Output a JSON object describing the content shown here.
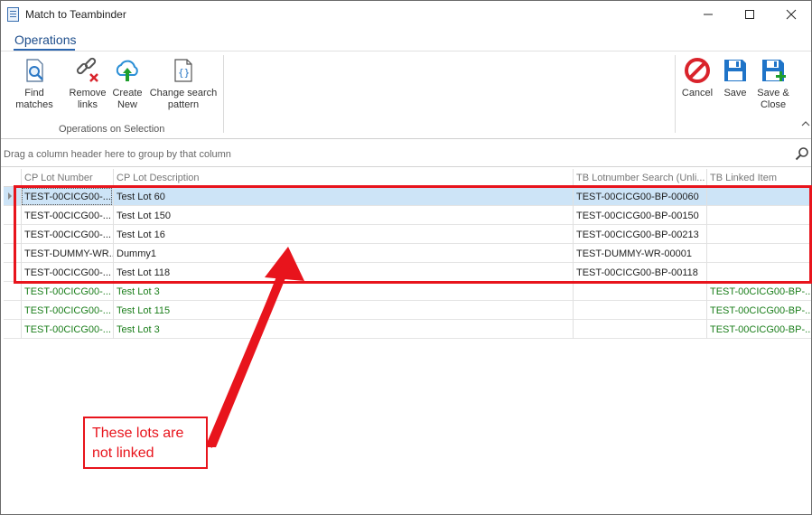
{
  "window": {
    "title": "Match to Teambinder"
  },
  "ribbon": {
    "tab": "Operations",
    "buttons": {
      "find_matches": "Find matches",
      "remove_links_1": "Remove",
      "remove_links_2": "links",
      "create_new_1": "Create",
      "create_new_2": "New",
      "change_pattern_1": "Change search",
      "change_pattern_2": "pattern",
      "cancel": "Cancel",
      "save": "Save",
      "save_close_1": "Save &",
      "save_close_2": "Close"
    },
    "group_label": "Operations on Selection"
  },
  "group_panel": {
    "hint": "Drag a column header here to group by that column"
  },
  "grid": {
    "columns": [
      "CP Lot Number",
      "CP Lot Description",
      "TB Lotnumber Search (Unli...",
      "TB Linked Item"
    ],
    "rows": [
      {
        "cp_lot_number": "TEST-00CICG00-...",
        "cp_lot_description": "Test Lot 60",
        "tb_search": "TEST-00CICG00-BP-00060",
        "tb_linked": ""
      },
      {
        "cp_lot_number": "TEST-00CICG00-...",
        "cp_lot_description": "Test Lot 150",
        "tb_search": "TEST-00CICG00-BP-00150",
        "tb_linked": ""
      },
      {
        "cp_lot_number": "TEST-00CICG00-...",
        "cp_lot_description": "Test Lot 16",
        "tb_search": "TEST-00CICG00-BP-00213",
        "tb_linked": ""
      },
      {
        "cp_lot_number": "TEST-DUMMY-WR...",
        "cp_lot_description": "Dummy1",
        "tb_search": "TEST-DUMMY-WR-00001",
        "tb_linked": ""
      },
      {
        "cp_lot_number": "TEST-00CICG00-...",
        "cp_lot_description": "Test Lot 118",
        "tb_search": "TEST-00CICG00-BP-00118",
        "tb_linked": ""
      },
      {
        "cp_lot_number": "TEST-00CICG00-...",
        "cp_lot_description": "Test Lot 3",
        "tb_search": "",
        "tb_linked": "TEST-00CICG00-BP-..."
      },
      {
        "cp_lot_number": "TEST-00CICG00-...",
        "cp_lot_description": "Test Lot 115",
        "tb_search": "",
        "tb_linked": "TEST-00CICG00-BP-..."
      },
      {
        "cp_lot_number": "TEST-00CICG00-...",
        "cp_lot_description": "Test Lot 3",
        "tb_search": "",
        "tb_linked": "TEST-00CICG00-BP-..."
      }
    ]
  },
  "annotation": {
    "line1": "These lots are",
    "line2": "not linked"
  },
  "colors": {
    "linked_text": "#1a7e1a",
    "annotation_red": "#e8141c",
    "selection": "#cde4f7",
    "ribbon_accent": "#2b66b0"
  },
  "icons": {
    "find_matches": "magnifier-document-icon",
    "remove_links": "broken-link-icon",
    "create_new": "cloud-upload-icon",
    "change_pattern": "braces-document-icon",
    "cancel": "no-entry-icon",
    "save": "floppy-disk-icon",
    "save_close": "floppy-disk-plus-icon"
  }
}
